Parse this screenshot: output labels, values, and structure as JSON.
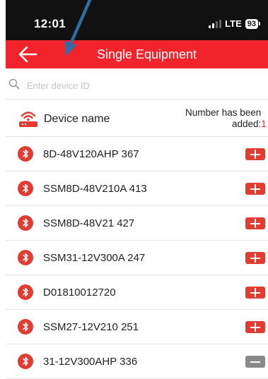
{
  "status_bar": {
    "time": "12:01",
    "network": "LTE",
    "battery": "93"
  },
  "header": {
    "title": "Single Equipment"
  },
  "search": {
    "placeholder": "Enter device ID"
  },
  "list_header": {
    "device_name_label": "Device name",
    "count_label_line1": "Number has been",
    "count_label_line2": "added:",
    "count_value": "1"
  },
  "devices": [
    {
      "name": "8D-48V120AHP 367",
      "action": "add"
    },
    {
      "name": "SSM8D-48V210A 413",
      "action": "add"
    },
    {
      "name": "SSM8D-48V21 427",
      "action": "add"
    },
    {
      "name": "SSM31-12V300A 247",
      "action": "add"
    },
    {
      "name": "D01810012720",
      "action": "add"
    },
    {
      "name": "SSM27-12V210 251",
      "action": "add"
    },
    {
      "name": "31-12V300AHP 336",
      "action": "remove"
    }
  ],
  "colors": {
    "accent_red": "#f2242b",
    "status_bar_bg": "#111111",
    "remove_gray": "#8a8a8a",
    "annotation_arrow": "#2e6da4"
  }
}
